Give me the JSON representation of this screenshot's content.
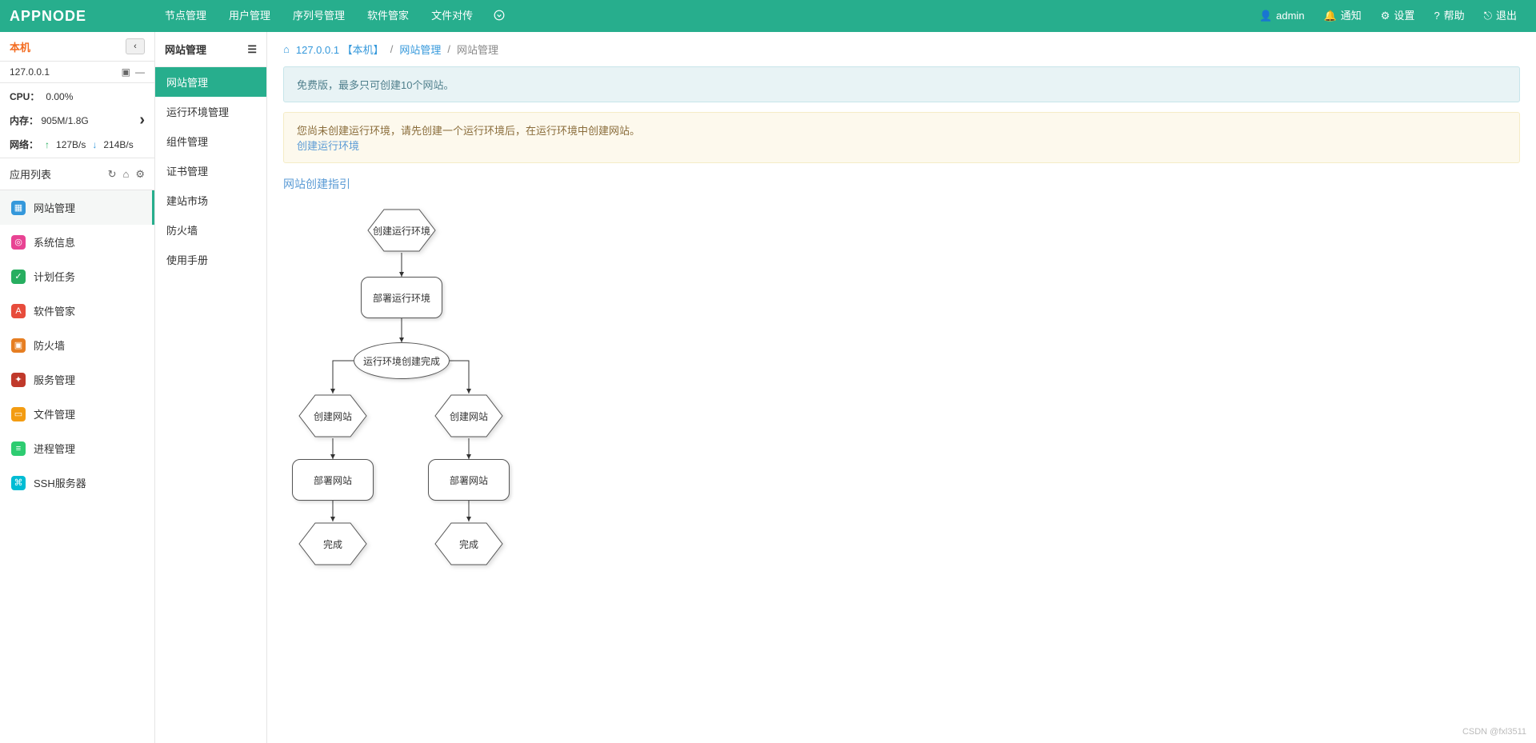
{
  "brand": "APPNODE",
  "topnav": {
    "items": [
      "节点管理",
      "用户管理",
      "序列号管理",
      "软件管家",
      "文件对传"
    ],
    "right": {
      "user": "admin",
      "notify": "通知",
      "settings": "设置",
      "help": "帮助",
      "logout": "退出"
    }
  },
  "host": {
    "name": "本机",
    "ip": "127.0.0.1"
  },
  "stats": {
    "cpu_label": "CPU：",
    "cpu_value": "0.00%",
    "mem_label": "内存：",
    "mem_value": "905M/1.8G",
    "net_label": "网络：",
    "net_up": "127B/s",
    "net_down": "214B/s"
  },
  "applist": {
    "title": "应用列表",
    "items": [
      {
        "label": "网站管理",
        "active": true,
        "cls": "ico-blue",
        "g": "▦"
      },
      {
        "label": "系统信息",
        "active": false,
        "cls": "ico-pink",
        "g": "◎"
      },
      {
        "label": "计划任务",
        "active": false,
        "cls": "ico-green",
        "g": "✓"
      },
      {
        "label": "软件管家",
        "active": false,
        "cls": "ico-red",
        "g": "A"
      },
      {
        "label": "防火墙",
        "active": false,
        "cls": "ico-orange",
        "g": "▣"
      },
      {
        "label": "服务管理",
        "active": false,
        "cls": "ico-dred",
        "g": "✦"
      },
      {
        "label": "文件管理",
        "active": false,
        "cls": "ico-yel",
        "g": "▭"
      },
      {
        "label": "进程管理",
        "active": false,
        "cls": "ico-lgreen",
        "g": "≡"
      },
      {
        "label": "SSH服务器",
        "active": false,
        "cls": "ico-lblue",
        "g": "⌘"
      }
    ]
  },
  "submenu": {
    "title": "网站管理",
    "items": [
      {
        "label": "网站管理",
        "active": true
      },
      {
        "label": "运行环境管理",
        "active": false
      },
      {
        "label": "组件管理",
        "active": false
      },
      {
        "label": "证书管理",
        "active": false
      },
      {
        "label": "建站市场",
        "active": false
      },
      {
        "label": "防火墙",
        "active": false
      },
      {
        "label": "使用手册",
        "active": false
      }
    ]
  },
  "breadcrumb": {
    "node": "127.0.0.1 【本机】",
    "level1": "网站管理",
    "level2": "网站管理"
  },
  "alerts": {
    "info": "免费版，最多只可创建10个网站。",
    "warn_text": "您尚未创建运行环境，请先创建一个运行环境后，在运行环境中创建网站。",
    "warn_link": "创建运行环境"
  },
  "section_title": "网站创建指引",
  "flow": {
    "n1": "创建运行环境",
    "n2": "部署运行环境",
    "n3": "运行环境创建完成",
    "n4a": "创建网站",
    "n4b": "创建网站",
    "n5a": "部署网站",
    "n5b": "部署网站",
    "n6a": "完成",
    "n6b": "完成"
  },
  "watermark": "CSDN @fxl3511"
}
